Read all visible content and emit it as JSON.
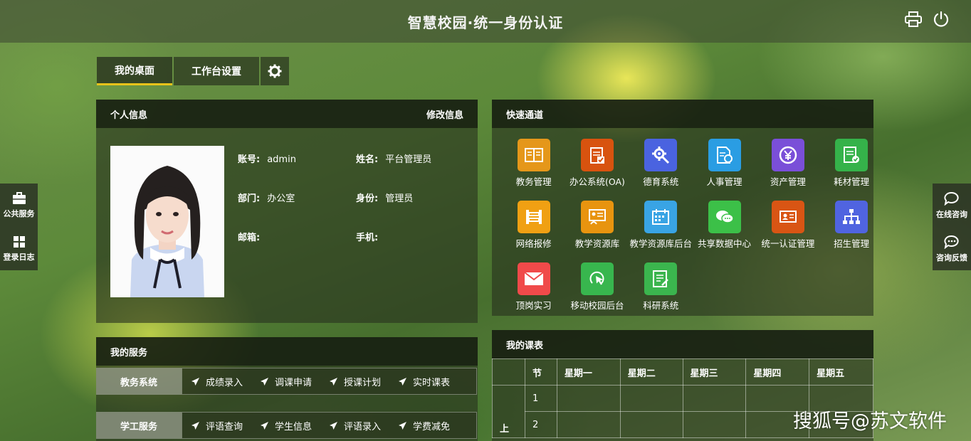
{
  "header": {
    "title": "智慧校园·统一身份认证",
    "icons": [
      "printer-icon",
      "power-icon"
    ]
  },
  "tabs": [
    {
      "label": "我的桌面",
      "active": true
    },
    {
      "label": "工作台设置",
      "active": false
    }
  ],
  "personal": {
    "title": "个人信息",
    "edit_label": "修改信息",
    "fields": {
      "account_label": "账号:",
      "account_value": "admin",
      "name_label": "姓名:",
      "name_value": "平台管理员",
      "dept_label": "部门:",
      "dept_value": "办公室",
      "identity_label": "身份:",
      "identity_value": "管理员",
      "email_label": "邮箱:",
      "email_value": "",
      "phone_label": "手机:",
      "phone_value": ""
    }
  },
  "quick": {
    "title": "快速通道",
    "items": [
      {
        "label": "教务管理",
        "color": "#e5971a",
        "icon": "book-icon"
      },
      {
        "label": "办公系统(OA)",
        "color": "#d8530f",
        "icon": "clipboard-check-icon"
      },
      {
        "label": "德育系统",
        "color": "#4a63e0",
        "icon": "gear-wrench-icon"
      },
      {
        "label": "人事管理",
        "color": "#2a9de3",
        "icon": "document-person-icon"
      },
      {
        "label": "资产管理",
        "color": "#7a4fd8",
        "icon": "yuan-coin-icon"
      },
      {
        "label": "耗材管理",
        "color": "#35b24a",
        "icon": "document-badge-icon"
      },
      {
        "label": "网络报修",
        "color": "#f0a013",
        "icon": "bed-icon"
      },
      {
        "label": "教学资源库",
        "color": "#e8940f",
        "icon": "presentation-icon"
      },
      {
        "label": "教学资源库后台",
        "color": "#39a4e4",
        "icon": "calendar-icon"
      },
      {
        "label": "共享数据中心",
        "color": "#3cc048",
        "icon": "chat-icon"
      },
      {
        "label": "统一认证管理",
        "color": "#d95514",
        "icon": "id-card-icon"
      },
      {
        "label": "招生管理",
        "color": "#5064e0",
        "icon": "org-chart-icon"
      },
      {
        "label": "顶岗实习",
        "color": "#f04a4a",
        "icon": "mail-icon"
      },
      {
        "label": "移动校园后台",
        "color": "#38b64e",
        "icon": "pointer-icon"
      },
      {
        "label": "科研系统",
        "color": "#3bb54e",
        "icon": "notes-icon"
      }
    ]
  },
  "services": {
    "title": "我的服务",
    "rows": [
      {
        "category": "教务系统",
        "items": [
          "成绩录入",
          "调课申请",
          "授课计划",
          "实时课表"
        ]
      },
      {
        "category": "学工服务",
        "items": [
          "评语查询",
          "学生信息",
          "评语录入",
          "学费减免"
        ]
      }
    ]
  },
  "schedule": {
    "title": "我的课表",
    "headers": [
      "",
      "节",
      "星期一",
      "星期二",
      "星期三",
      "星期四",
      "星期五"
    ],
    "period_label": "上",
    "rows": [
      "1",
      "2"
    ]
  },
  "left_side": [
    {
      "label": "公共服务",
      "icon": "briefcase-icon"
    },
    {
      "label": "登录日志",
      "icon": "grid-icon"
    }
  ],
  "right_side": [
    {
      "label": "在线咨询",
      "icon": "chat-bubble-icon"
    },
    {
      "label": "咨询反馈",
      "icon": "chat-dots-icon"
    }
  ],
  "watermark": "搜狐号@苏文软件"
}
